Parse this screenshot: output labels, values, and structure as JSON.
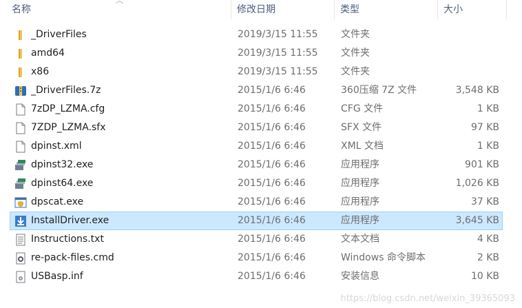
{
  "columns": {
    "name": "名称",
    "date": "修改日期",
    "type": "类型",
    "size": "大小"
  },
  "files": [
    {
      "name": "_DriverFiles",
      "date": "2019/3/15 11:55",
      "type": "文件夹",
      "size": "",
      "icon": "folder-icon",
      "selected": false
    },
    {
      "name": "amd64",
      "date": "2019/3/15 11:55",
      "type": "文件夹",
      "size": "",
      "icon": "folder-icon",
      "selected": false
    },
    {
      "name": "x86",
      "date": "2019/3/15 11:55",
      "type": "文件夹",
      "size": "",
      "icon": "folder-icon",
      "selected": false
    },
    {
      "name": "_DriverFiles.7z",
      "date": "2015/1/6 6:46",
      "type": "360压缩 7Z 文件",
      "size": "3,548 KB",
      "icon": "archive-icon",
      "selected": false
    },
    {
      "name": "7zDP_LZMA.cfg",
      "date": "2015/1/6 6:46",
      "type": "CFG 文件",
      "size": "1 KB",
      "icon": "file-icon",
      "selected": false
    },
    {
      "name": "7ZDP_LZMA.sfx",
      "date": "2015/1/6 6:46",
      "type": "SFX 文件",
      "size": "97 KB",
      "icon": "file-icon",
      "selected": false
    },
    {
      "name": "dpinst.xml",
      "date": "2015/1/6 6:46",
      "type": "XML 文档",
      "size": "1 KB",
      "icon": "file-icon",
      "selected": false
    },
    {
      "name": "dpinst32.exe",
      "date": "2015/1/6 6:46",
      "type": "应用程序",
      "size": "901 KB",
      "icon": "installer-icon",
      "selected": false
    },
    {
      "name": "dpinst64.exe",
      "date": "2015/1/6 6:46",
      "type": "应用程序",
      "size": "1,026 KB",
      "icon": "installer-icon",
      "selected": false
    },
    {
      "name": "dpscat.exe",
      "date": "2015/1/6 6:46",
      "type": "应用程序",
      "size": "37 KB",
      "icon": "shield-exe-icon",
      "selected": false
    },
    {
      "name": "InstallDriver.exe",
      "date": "2015/1/6 6:46",
      "type": "应用程序",
      "size": "3,645 KB",
      "icon": "download-exe-icon",
      "selected": true
    },
    {
      "name": "Instructions.txt",
      "date": "2015/1/6 6:46",
      "type": "文本文档",
      "size": "4 KB",
      "icon": "text-file-icon",
      "selected": false
    },
    {
      "name": "re-pack-files.cmd",
      "date": "2015/1/6 6:46",
      "type": "Windows 命令脚本",
      "size": "2 KB",
      "icon": "gear-file-icon",
      "selected": false
    },
    {
      "name": "USBasp.inf",
      "date": "2015/1/6 6:46",
      "type": "安装信息",
      "size": "10 KB",
      "icon": "settings-file-icon",
      "selected": false
    }
  ],
  "watermark": "https://blog.csdn.net/weixin_39365093",
  "colors": {
    "selected_bg": "#cce8ff",
    "selected_border": "#99d1ff",
    "folder": "#e8b84a",
    "header_text": "#4c607a"
  }
}
